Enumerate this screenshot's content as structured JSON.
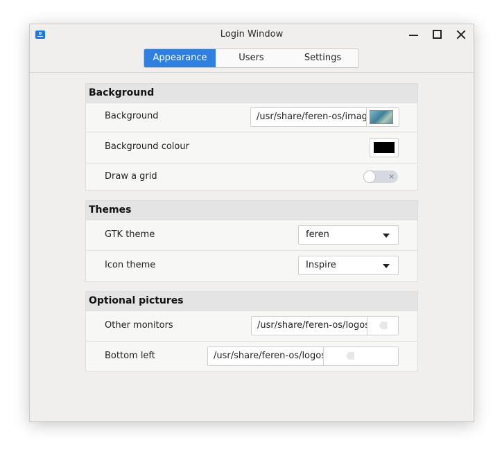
{
  "window": {
    "title": "Login Window"
  },
  "tabs": [
    {
      "label": "Appearance",
      "active": true
    },
    {
      "label": "Users",
      "active": false
    },
    {
      "label": "Settings",
      "active": false
    }
  ],
  "background": {
    "heading": "Background",
    "background_label": "Background",
    "background_path": "/usr/share/feren-os/imag",
    "colour_label": "Background colour",
    "colour_value": "#000000",
    "grid_label": "Draw a grid",
    "grid_enabled": false,
    "grid_toggle_glyph": "×"
  },
  "themes": {
    "heading": "Themes",
    "gtk_label": "GTK theme",
    "gtk_value": "feren",
    "icon_label": "Icon theme",
    "icon_value": "Inspire"
  },
  "optional": {
    "heading": "Optional pictures",
    "monitors_label": "Other monitors",
    "monitors_path": "/usr/share/feren-os/logos",
    "bottom_label": "Bottom left",
    "bottom_path": "/usr/share/feren-os/logos"
  },
  "colors": {
    "accent": "#2f7fe0"
  }
}
